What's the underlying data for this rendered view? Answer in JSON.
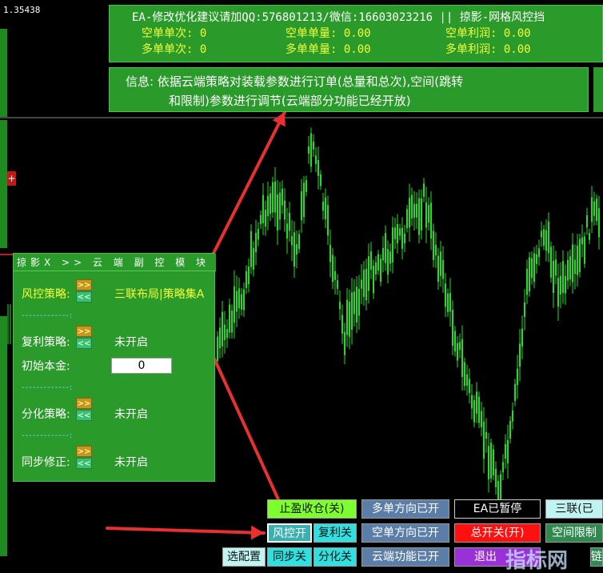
{
  "price_label": "1.35438",
  "red_tag": "+",
  "info_panel": {
    "header": "EA-修改优化建议请加QQ:576801213/微信:16603023216 || 掠影-网格风控挡",
    "short_count": "空单单次: 0",
    "short_volume": "空单单量: 0.00",
    "short_profit": "空单利润: 0.00",
    "long_count": "多单单次: 0",
    "long_volume": "多单单量: 0.00",
    "long_profit": "多单利润: 0.00"
  },
  "message": {
    "line1": "信息: 依据云端策略对装载参数进行订单(总量和总次),空间(跳转",
    "line2": "和限制)参数进行调节(云端部分功能已经开放)"
  },
  "cloud_panel": {
    "title": "掠影X >> 云 端 副 控 模 块",
    "separator": "-------------:",
    "risk_label": "风控策略:",
    "risk_value": "三联布局|策略集A",
    "compound_label": "复利策略:",
    "compound_value": "未开启",
    "capital_label": "初始本金:",
    "capital_value": "0",
    "split_label": "分化策略:",
    "split_value": "未开启",
    "sync_label": "同步修正:",
    "sync_value": "未开启",
    "arrow_up": ">>",
    "arrow_down": "<<"
  },
  "buttons": {
    "tp_close": "止盈收仓(关)",
    "long_dir": "多单方向已开",
    "ea_paused": "EA已暂停",
    "triple": "三联(已",
    "risk_on": "风控开",
    "compound_off": "复利关",
    "short_dir": "空单方向已开",
    "master_switch": "总开关(开)",
    "space_limit": "空间限制",
    "select_config": "选配置",
    "sync_off": "同步关",
    "split_off": "分化关",
    "cloud_on": "云端功能已开",
    "exit": "退出",
    "watermark": "指标网",
    "last": "链"
  },
  "colors": {
    "panel_green": "#2a9a2a",
    "candle_green": "#1ee01e",
    "highlight_yellow": "#f4ff3a",
    "arrow_red": "#e83030"
  }
}
